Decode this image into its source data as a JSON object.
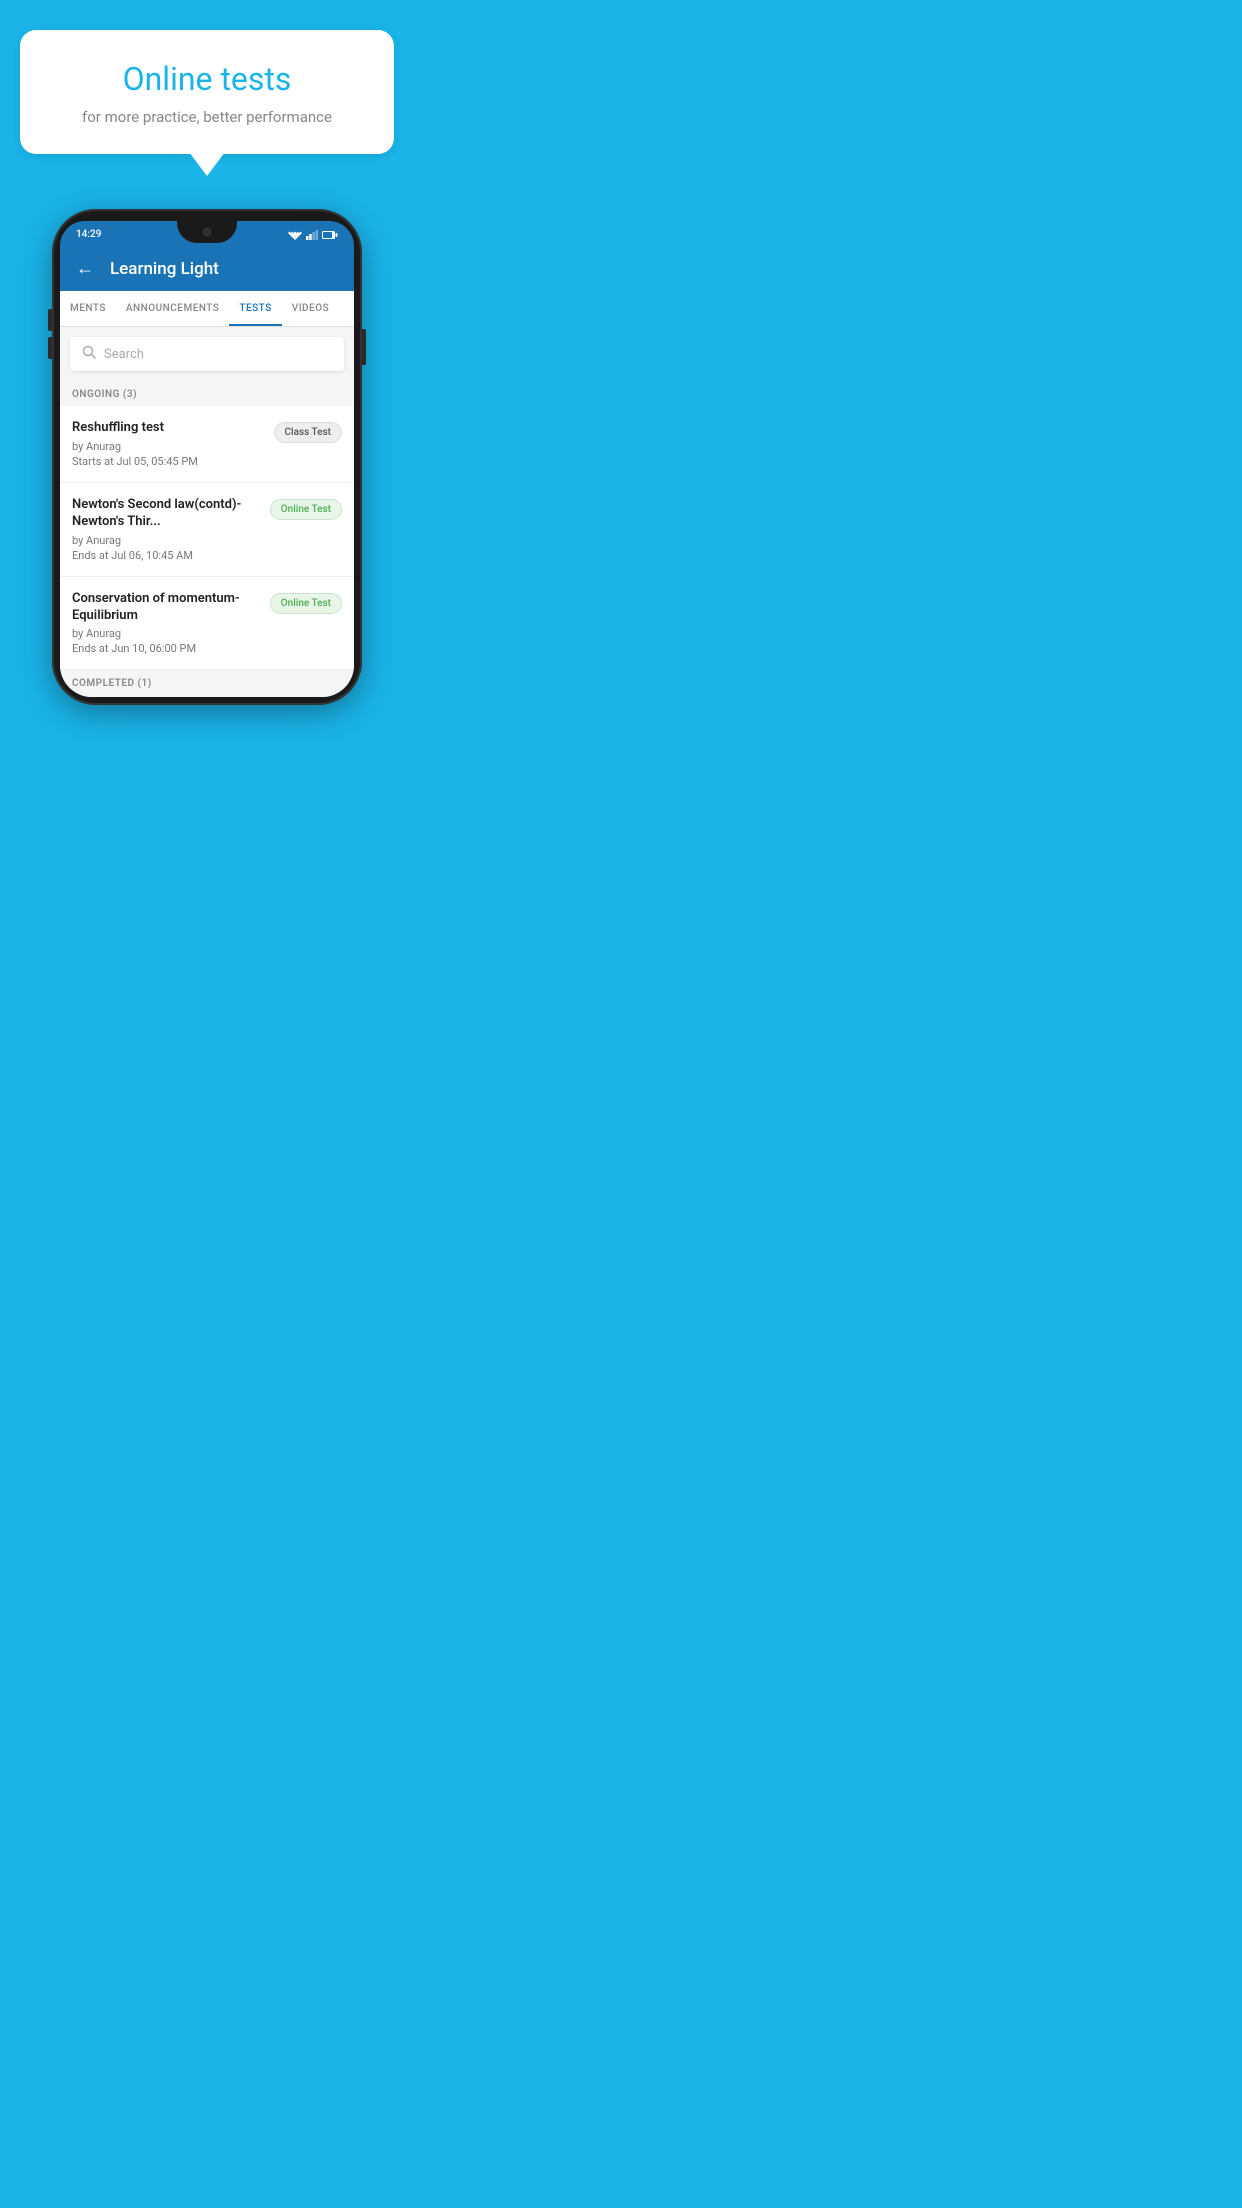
{
  "background_color": "#1ab4e8",
  "hero": {
    "title": "Online tests",
    "subtitle": "for more practice, better performance"
  },
  "phone": {
    "status": {
      "time": "14:29"
    },
    "header": {
      "title": "Learning Light",
      "back_label": "←"
    },
    "tabs": [
      {
        "label": "MENTS",
        "active": false
      },
      {
        "label": "ANNOUNCEMENTS",
        "active": false
      },
      {
        "label": "TESTS",
        "active": true
      },
      {
        "label": "VIDEOS",
        "active": false
      }
    ],
    "search": {
      "placeholder": "Search"
    },
    "sections": [
      {
        "label": "ONGOING (3)",
        "tests": [
          {
            "name": "Reshuffling test",
            "author": "by Anurag",
            "time": "Starts at  Jul 05, 05:45 PM",
            "badge": "Class Test",
            "badge_type": "class"
          },
          {
            "name": "Newton's Second law(contd)-Newton's Thir...",
            "author": "by Anurag",
            "time": "Ends at  Jul 06, 10:45 AM",
            "badge": "Online Test",
            "badge_type": "online"
          },
          {
            "name": "Conservation of momentum-Equilibrium",
            "author": "by Anurag",
            "time": "Ends at  Jun 10, 06:00 PM",
            "badge": "Online Test",
            "badge_type": "online"
          }
        ]
      }
    ],
    "completed_label": "COMPLETED (1)"
  }
}
